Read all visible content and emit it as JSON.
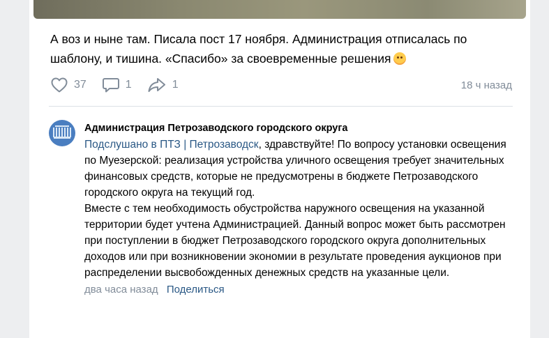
{
  "post": {
    "text": "А воз и ныне там. Писала пост 17 ноября. Администрация отписалась по шаблону, и тишина. «Спасибо» за своевременные решения",
    "emoji": "face-icon"
  },
  "actions": {
    "likes": "37",
    "comments": "1",
    "shares": "1",
    "time": "18 ч назад"
  },
  "reply": {
    "author": "Администрация Петрозаводского городского округа",
    "mention": "Подслушано в ПТЗ | Петрозаводск",
    "text_after_mention": ", здравствуйте! По вопросу установки освещения по Муезерской: реализация устройства уличного освещения требует значительных финансовых средств, которые не предусмотрены в бюджете Петрозаводского городского округа на текущий год.",
    "text_second": "Вместе с тем необходимость обустройства наружного освещения на указанной территории будет учтена Администрацией. Данный вопрос может быть рассмотрен при поступлении в бюджет Петрозаводского городского округа дополнительных доходов или при возникновении экономии в результате проведения аукционов при распределении высвобожденных денежных средств на указанные цели.",
    "time": "два часа назад",
    "share_label": "Поделиться"
  }
}
